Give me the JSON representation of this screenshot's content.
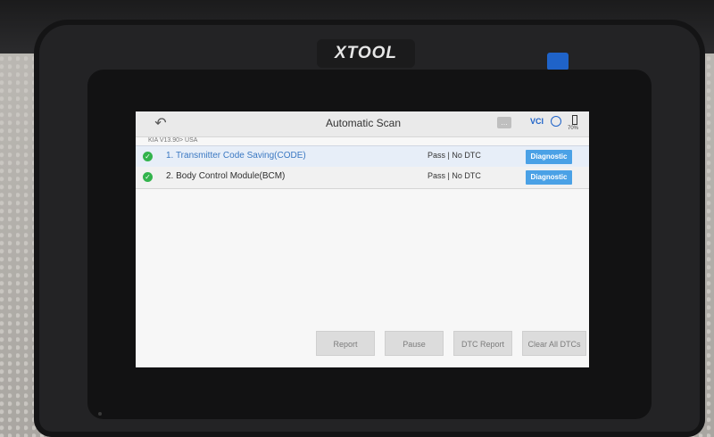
{
  "device": {
    "brand": "XTOOL"
  },
  "header": {
    "title": "Automatic Scan",
    "back_icon": "↶",
    "vci_label": "VCI",
    "battery_text": "70%"
  },
  "breadcrumb": "KIA V13.90> USA",
  "rows": [
    {
      "name": "1. Transmitter Code Saving(CODE)",
      "status": "Pass | No DTC",
      "button": "Diagnostic"
    },
    {
      "name": "2. Body Control Module(BCM)",
      "status": "Pass | No DTC",
      "button": "Diagnostic"
    }
  ],
  "bottom_buttons": {
    "report": "Report",
    "pause": "Pause",
    "dtc_report": "DTC Report",
    "clear_all": "Clear All DTCs"
  },
  "icons": {
    "check": "✓",
    "message": "…"
  },
  "colors": {
    "accent": "#4aa1e6",
    "success": "#32b34c",
    "blue_tab": "#1f63c9"
  }
}
